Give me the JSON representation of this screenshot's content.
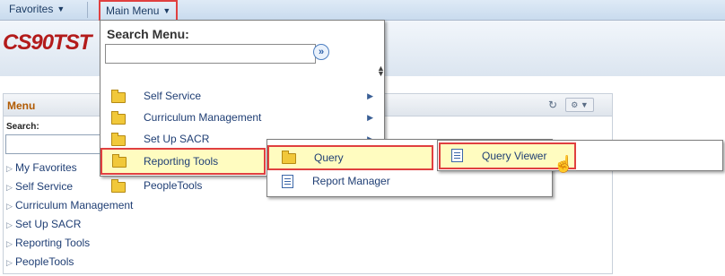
{
  "topbar": {
    "favorites": "Favorites",
    "main_menu": "Main Menu"
  },
  "brand": "CS90TST",
  "menu_pagelet": {
    "title": "Menu",
    "search_label": "Search:",
    "items": [
      "My Favorites",
      "Self Service",
      "Curriculum Management",
      "Set Up SACR",
      "Reporting Tools",
      "PeopleTools"
    ]
  },
  "main_menu_dropdown": {
    "search_title": "Search Menu:",
    "search_value": "",
    "items": [
      "Self Service",
      "Curriculum Management",
      "Set Up SACR",
      "Reporting Tools",
      "PeopleTools"
    ],
    "highlighted": "Reporting Tools"
  },
  "reporting_tools_submenu": {
    "items": [
      "Query",
      "Report Manager"
    ],
    "highlighted": "Query"
  },
  "query_submenu": {
    "items": [
      "Query Viewer"
    ],
    "highlighted": "Query Viewer"
  },
  "colors": {
    "highlight_border": "#e04040",
    "highlight_fill": "#fffcc0",
    "brand": "#b31b1b",
    "link": "#1f3e74"
  },
  "icons": {
    "folder": "folder-icon",
    "document": "document-icon",
    "cursor": "hand-pointer-icon"
  }
}
